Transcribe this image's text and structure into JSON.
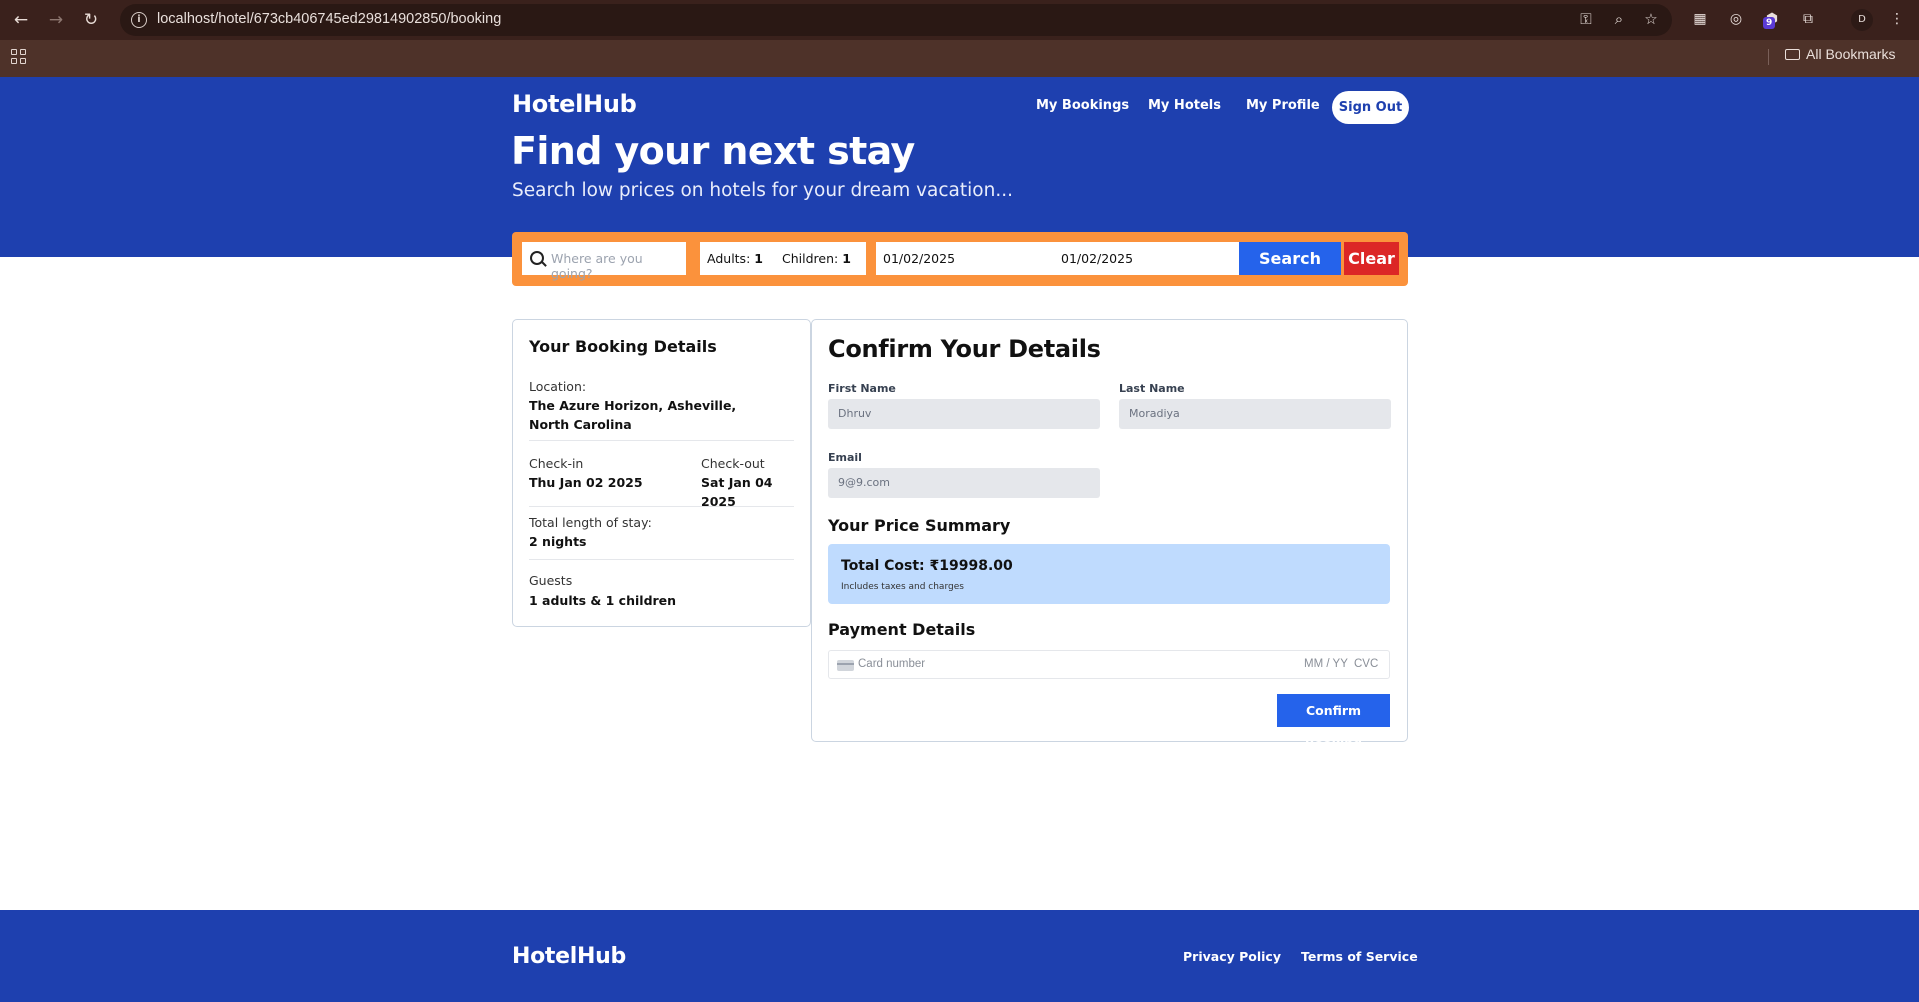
{
  "browser": {
    "url": "localhost/hotel/673cb406745ed29814902850/booking",
    "bookmarks_label": "All Bookmarks",
    "extension_badge": "9",
    "profile_initial": "D"
  },
  "header": {
    "logo": "HotelHub",
    "nav": [
      "My Bookings",
      "My Hotels",
      "My Profile"
    ],
    "signout_label": "Sign Out",
    "title": "Find your next stay",
    "subtitle": "Search low prices on hotels for your dream vacation..."
  },
  "search": {
    "destination_placeholder": "Where are you going?",
    "adults_label": "Adults:",
    "adults_value": "1",
    "children_label": "Children:",
    "children_value": "1",
    "checkin": "01/02/2025",
    "checkout": "01/02/2025",
    "search_label": "Search",
    "clear_label": "Clear"
  },
  "summary": {
    "heading": "Your Booking Details",
    "location_label": "Location:",
    "location_value": "The Azure Horizon, Asheville, North Carolina",
    "checkin_label": "Check-in",
    "checkin_value": "Thu Jan 02 2025",
    "checkout_label": "Check-out",
    "checkout_value": "Sat Jan 04 2025",
    "length_label": "Total length of stay:",
    "length_value": "2 nights",
    "guests_label": "Guests",
    "guests_value": "1 adults & 1 children"
  },
  "confirm": {
    "heading": "Confirm Your Details",
    "first_name_label": "First Name",
    "first_name_value": "Dhruv",
    "last_name_label": "Last Name",
    "last_name_value": "Moradiya",
    "email_label": "Email",
    "email_value": "9@9.com",
    "price_heading": "Your Price Summary",
    "total_cost": "Total Cost: ₹19998.00",
    "price_note": "Includes taxes and charges",
    "payment_heading": "Payment Details",
    "card_placeholder": "Card number",
    "expiry_placeholder": "MM / YY",
    "cvc_placeholder": "CVC",
    "confirm_label": "Confirm Booking"
  },
  "footer": {
    "logo": "HotelHub",
    "links": [
      "Privacy Policy",
      "Terms of Service"
    ]
  },
  "colors": {
    "brand_blue": "#1e40af",
    "button_blue": "#2563eb",
    "search_orange": "#fb923c",
    "clear_red": "#dc2626",
    "price_box": "#bfdbfe"
  },
  "icons": [
    "back-icon",
    "forward-icon",
    "reload-icon",
    "site-info-icon",
    "key-icon",
    "zoom-icon",
    "star-icon",
    "extension-icon",
    "puzzle-icon",
    "menu-icon",
    "apps-icon",
    "folder-icon",
    "search-icon",
    "card-icon"
  ]
}
